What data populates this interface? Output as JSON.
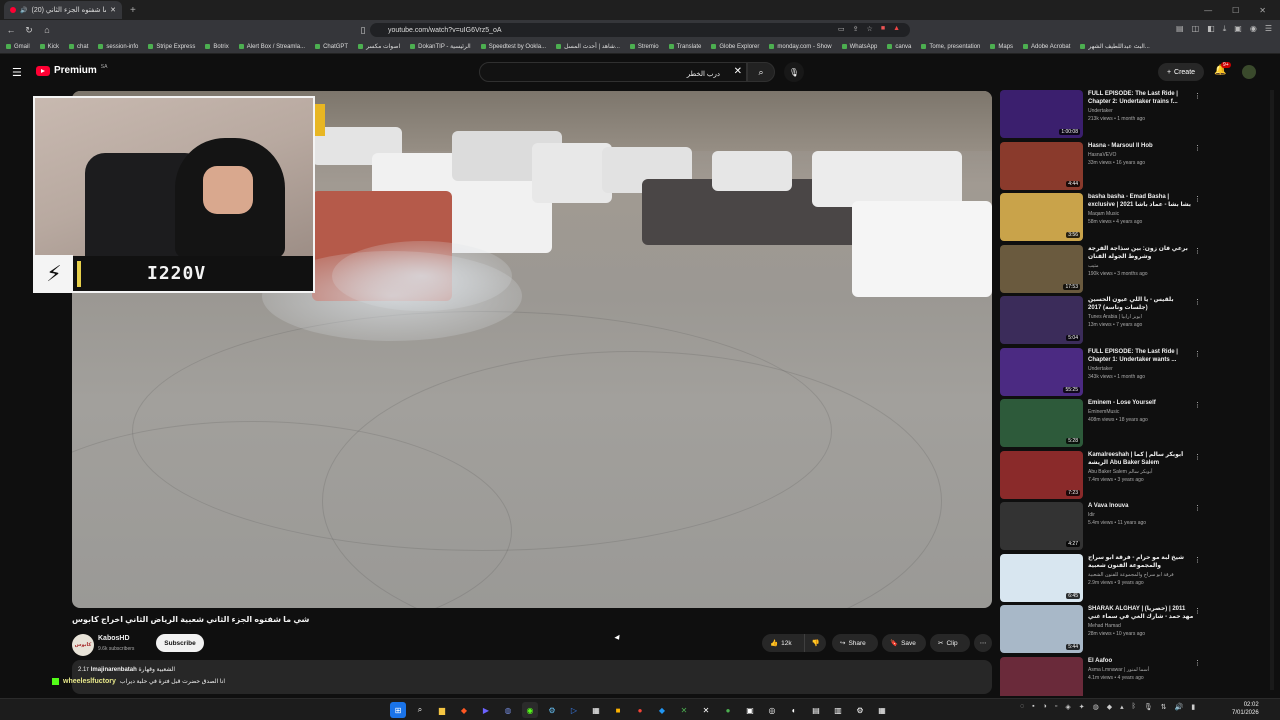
{
  "browser": {
    "tab_title": "(20) شي ما شفتوه الجزء الثاني",
    "new_tab": "+",
    "url": "youtube.com/watch?v=uIG6Vrz5_oA",
    "bookmarks": [
      "Gmail",
      "Kick",
      "chat",
      "session-info",
      "Stripe Express",
      "Botrix",
      "Alert Box / Streamla...",
      "ChatGPT",
      "اصوات مكسر",
      "DokanTIP - الرئيسية",
      "Speedtest by Ookla...",
      "شاهد | أحدث المسل...",
      "Stremio",
      "Translate",
      "Globe Explorer",
      "monday.com - Show",
      "WhatsApp",
      "canva",
      "Tome, presentation",
      "Maps",
      "Adobe Acrobat",
      "البث عبداللطيف الشهر..."
    ]
  },
  "youtube": {
    "logo_text": "Premium",
    "region": "SA",
    "search_value": "درب الخطر",
    "create_label": "Create",
    "notif_count": "9+"
  },
  "overlay": {
    "streamer_name": "I220V",
    "chat_user": "wheeleslfuctory",
    "chat_prefix": "2.1т",
    "chat_prefix_overlap": "lmajinarenbatah",
    "chat_comment": "الشعبية وقهارة",
    "chat_message": "انا الصدق حضرت قبل فترة في حلبة ديراب"
  },
  "video": {
    "title": "شي ما شفتوه الجزء الثاني شعبية الرياض الثاني اخراج كابوس",
    "channel": "KabosHD",
    "channel_avatar_text": "كابوس",
    "subscribers": "9.6k subscribers",
    "subscribe_label": "Subscribe",
    "likes": "12k",
    "share_label": "Share",
    "save_label": "Save",
    "clip_label": "Clip"
  },
  "recommendations": [
    {
      "title": "FULL EPISODE: The Last Ride | Chapter 2: Undertaker trains f...",
      "channel": "Undertaker",
      "stats": "213k views • 1 month ago",
      "duration": "1:00:08",
      "color": "#3b1f6e"
    },
    {
      "title": "Hasna - Marsoul Il Hob",
      "channel": "HasnaVEVO",
      "stats": "33m views • 16 years ago",
      "duration": "4:44",
      "color": "#8a3a2c"
    },
    {
      "title": "basha basha - Emad Basha | exclusive | 2021 بشا بشا - عماد باشا",
      "channel": "Maqam Music",
      "stats": "58m views • 4 years ago",
      "duration": "3:56",
      "color": "#c9a34a"
    },
    {
      "title": "برعي فان زون: بين سذاجة الفرجة وشروط الجولة الفنان",
      "channel": "مثيب",
      "stats": "190k views • 3 months ago",
      "duration": "17:53",
      "color": "#6a5a3e"
    },
    {
      "title": "بلقيس - يا اللي عيون الحسين (جلسات وناسة) 2017",
      "channel": "Tunes Arabia | ايوبز ارابيا",
      "stats": "13m views • 7 years ago",
      "duration": "5:04",
      "color": "#3b2c5a"
    },
    {
      "title": "FULL EPISODE: The Last Ride | Chapter 1: Undertaker wants ...",
      "channel": "Undertaker",
      "stats": "343k views • 1 month ago",
      "duration": "55:25",
      "color": "#4b2a82"
    },
    {
      "title": "Eminem - Lose Yourself",
      "channel": "EminemMusic",
      "stats": "408m views • 18 years ago",
      "duration": "5:28",
      "color": "#2d5a3a"
    },
    {
      "title": "Kamalreeshah | أبوبكر سالم | كما الريشة Abu Baker Salem",
      "channel": "Abu Baker Salem أبوبكر سالم",
      "stats": "7.4m views • 3 years ago",
      "duration": "7:23",
      "color": "#8a2a2a"
    },
    {
      "title": "A Vava Inouva",
      "channel": "Idir",
      "stats": "5.4m views • 11 years ago",
      "duration": "4:27",
      "color": "#333333"
    },
    {
      "title": "شيخ لبة مو حرام - فرقة ابو سراج والمجموعة الفنون شعبية",
      "channel": "فرقة ابو سراج والمجموعة للفنون الشعبية",
      "stats": "2.9m views • 9 years ago",
      "duration": "6:45",
      "color": "#d8e6f0"
    },
    {
      "title": "SHARAK ALGHAY | (حصرياً) 2011 | مهد حمد - شارك الغي في سماء غني",
      "channel": "Mehad Hamad",
      "stats": "28m views • 10 years ago",
      "duration": "5:44",
      "color": "#a8b8c8"
    },
    {
      "title": "El Aafoo",
      "channel": "Asma Lmnawar | أسما لمنور",
      "stats": "4.1m views • 4 years ago",
      "duration": "4:23",
      "color": "#6a2a3a"
    }
  ],
  "taskbar": {
    "time": "02:02",
    "date": "7/01/2026"
  }
}
